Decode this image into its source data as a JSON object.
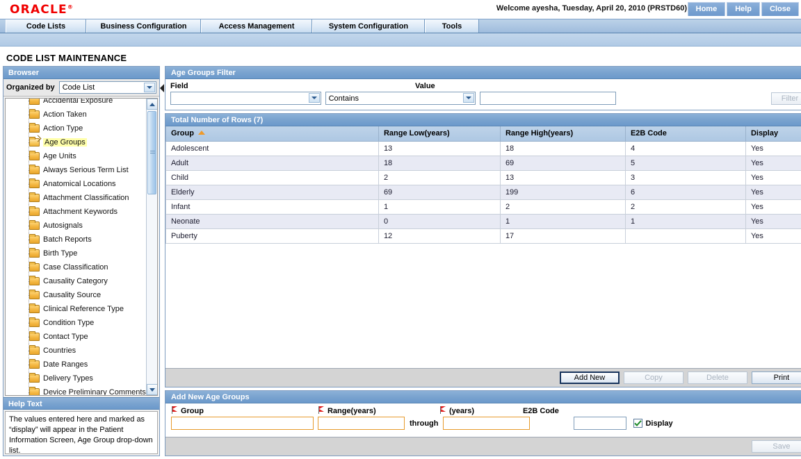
{
  "header": {
    "logo": "ORACLE",
    "logo_reg": "®",
    "welcome": "Welcome ayesha, Tuesday, April 20, 2010 (PRSTD60)",
    "links": [
      "Home",
      "Help",
      "Close"
    ]
  },
  "menu": {
    "tabs": [
      "Code Lists",
      "Business Configuration",
      "Access Management",
      "System Configuration",
      "Tools"
    ]
  },
  "page": {
    "title": "CODE LIST MAINTENANCE"
  },
  "browser": {
    "header": "Browser",
    "organized_by_label": "Organized by",
    "organized_by_value": "Code List",
    "tree_items": [
      {
        "label": "Accidental Exposure",
        "selected": false,
        "open": false
      },
      {
        "label": "Action Taken",
        "selected": false,
        "open": false
      },
      {
        "label": "Action Type",
        "selected": false,
        "open": false
      },
      {
        "label": "Age Groups",
        "selected": true,
        "open": true
      },
      {
        "label": "Age Units",
        "selected": false,
        "open": false
      },
      {
        "label": "Always Serious Term List",
        "selected": false,
        "open": false
      },
      {
        "label": "Anatomical Locations",
        "selected": false,
        "open": false
      },
      {
        "label": "Attachment Classification",
        "selected": false,
        "open": false
      },
      {
        "label": "Attachment Keywords",
        "selected": false,
        "open": false
      },
      {
        "label": "Autosignals",
        "selected": false,
        "open": false
      },
      {
        "label": "Batch Reports",
        "selected": false,
        "open": false
      },
      {
        "label": "Birth Type",
        "selected": false,
        "open": false
      },
      {
        "label": "Case Classification",
        "selected": false,
        "open": false
      },
      {
        "label": "Causality Category",
        "selected": false,
        "open": false
      },
      {
        "label": "Causality Source",
        "selected": false,
        "open": false
      },
      {
        "label": "Clinical Reference Type",
        "selected": false,
        "open": false
      },
      {
        "label": "Condition Type",
        "selected": false,
        "open": false
      },
      {
        "label": "Contact Type",
        "selected": false,
        "open": false
      },
      {
        "label": "Countries",
        "selected": false,
        "open": false
      },
      {
        "label": "Date Ranges",
        "selected": false,
        "open": false
      },
      {
        "label": "Delivery Types",
        "selected": false,
        "open": false
      },
      {
        "label": "Device Preliminary Comments",
        "selected": false,
        "open": false
      }
    ]
  },
  "help": {
    "header": "Help Text",
    "text": "The values entered here and marked as “display” will appear in the Patient Information Screen, Age Group drop-down list."
  },
  "filter": {
    "header": "Age Groups Filter",
    "field_label": "Field",
    "field_value": "",
    "operator_value": "Contains",
    "value_label": "Value",
    "value_text": "",
    "filter_button": "Filter"
  },
  "grid": {
    "header": "Total Number of Rows (7)",
    "columns": [
      "Group",
      "Range Low(years)",
      "Range High(years)",
      "E2B Code",
      "Display"
    ],
    "sort_column": "Group",
    "sort_direction": "asc",
    "rows": [
      [
        "Adolescent",
        "13",
        "18",
        "4",
        "Yes"
      ],
      [
        "Adult",
        "18",
        "69",
        "5",
        "Yes"
      ],
      [
        "Child",
        "2",
        "13",
        "3",
        "Yes"
      ],
      [
        "Elderly",
        "69",
        "199",
        "6",
        "Yes"
      ],
      [
        "Infant",
        "1",
        "2",
        "2",
        "Yes"
      ],
      [
        "Neonate",
        "0",
        "1",
        "1",
        "Yes"
      ],
      [
        "Puberty",
        "12",
        "17",
        "",
        "Yes"
      ]
    ],
    "buttons": [
      {
        "label": "Add New",
        "state": "focused"
      },
      {
        "label": "Copy",
        "state": "disabled"
      },
      {
        "label": "Delete",
        "state": "disabled"
      },
      {
        "label": "Print",
        "state": "enabled"
      }
    ]
  },
  "addform": {
    "header": "Add New Age Groups",
    "group_label": "Group",
    "group_value": "",
    "range_label": "Range(years)",
    "range_low_value": "",
    "through_label": "through",
    "years_label": "(years)",
    "range_high_value": "",
    "e2b_label": "E2B Code",
    "e2b_value": "",
    "display_label": "Display",
    "display_checked": true,
    "save_button": "Save"
  },
  "colors": {
    "brand_red": "#f00000",
    "panel_header_blue": "#7aa3cf",
    "table_header_blue": "#aec8e3",
    "row_alt": "#e8eaf4",
    "required_orange": "#e79a2b",
    "sort_arrow": "#ef9a2a",
    "selection_highlight": "#ffffaa"
  }
}
